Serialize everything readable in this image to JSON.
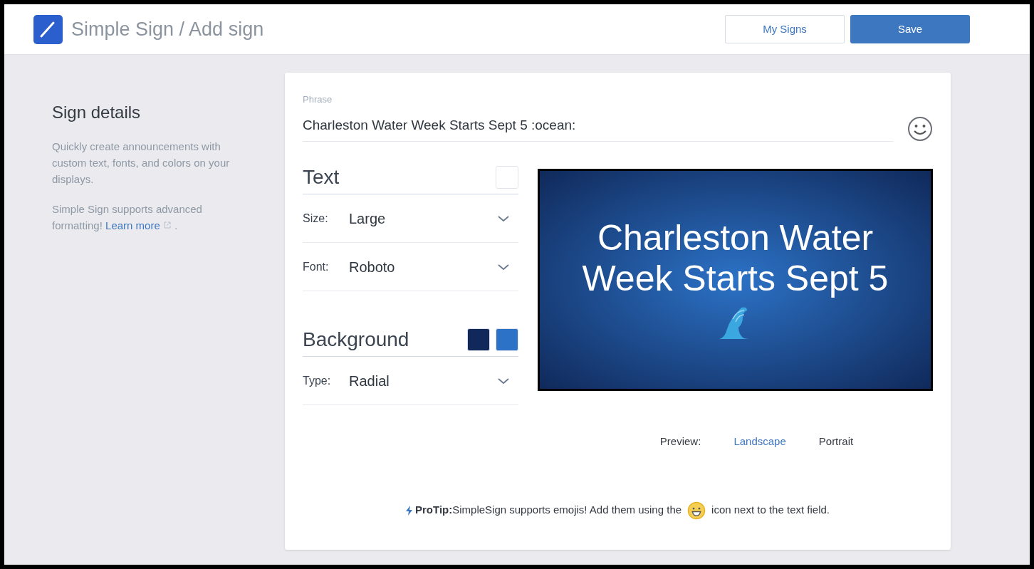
{
  "header": {
    "title": "Simple Sign / Add sign",
    "buttons": [
      {
        "label": "My Signs",
        "kind": "outline"
      },
      {
        "label": "Save",
        "kind": "primary"
      }
    ]
  },
  "sidebar": {
    "heading": "Sign details",
    "intro": "Quickly create announcements with custom text, fonts, and colors on your displays.",
    "note": "Simple Sign supports advanced formatting!",
    "link": "Learn more",
    "after": "."
  },
  "phrase": {
    "label": "Phrase",
    "value": "Charleston Water Week Starts Sept 5 :ocean:"
  },
  "text_section": {
    "title": "Text",
    "swatches": [
      {
        "color": "#ffffff"
      }
    ],
    "fields": [
      {
        "label": "Size:",
        "value": "Large"
      },
      {
        "label": "Font:",
        "value": "Roboto"
      }
    ]
  },
  "background_section": {
    "title": "Background",
    "swatches": [
      {
        "color": "#10295a"
      },
      {
        "color": "#2c72c6"
      }
    ],
    "fields": [
      {
        "label": "Type:",
        "value": "Radial"
      }
    ]
  },
  "preview": {
    "text": "Charleston Water Week Starts Sept 5",
    "label": "Preview:",
    "options": [
      {
        "label": "Landscape",
        "selected": true
      },
      {
        "label": "Portrait",
        "selected": false
      }
    ]
  },
  "protip": {
    "label": "ProTip:",
    "before": "SimpleSign supports emojis! Add them using the",
    "after": "icon next to the text field."
  }
}
